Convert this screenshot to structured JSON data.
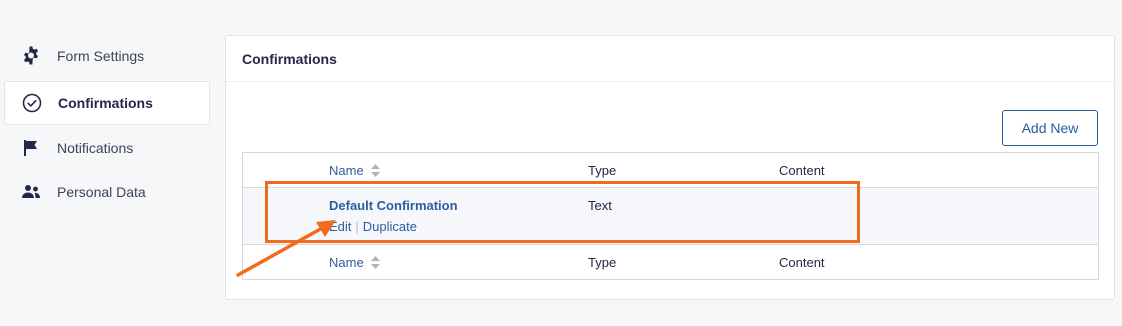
{
  "sidebar": {
    "items": [
      {
        "label": "Form Settings",
        "icon": "gear-icon",
        "active": false
      },
      {
        "label": "Confirmations",
        "icon": "check-circle-icon",
        "active": true
      },
      {
        "label": "Notifications",
        "icon": "flag-icon",
        "active": false
      },
      {
        "label": "Personal Data",
        "icon": "users-icon",
        "active": false
      }
    ]
  },
  "panel": {
    "title": "Confirmations",
    "add_new_label": "Add New"
  },
  "table": {
    "columns": [
      "Name",
      "Type",
      "Content"
    ],
    "rows": [
      {
        "name": "Default Confirmation",
        "type": "Text",
        "content": "",
        "actions": [
          "Edit",
          "Duplicate"
        ]
      }
    ],
    "footer_columns": [
      "Name",
      "Type",
      "Content"
    ]
  },
  "colors": {
    "accent": "#2c5da0",
    "annotation": "#f26b1d",
    "background": "#f6f7f9"
  }
}
